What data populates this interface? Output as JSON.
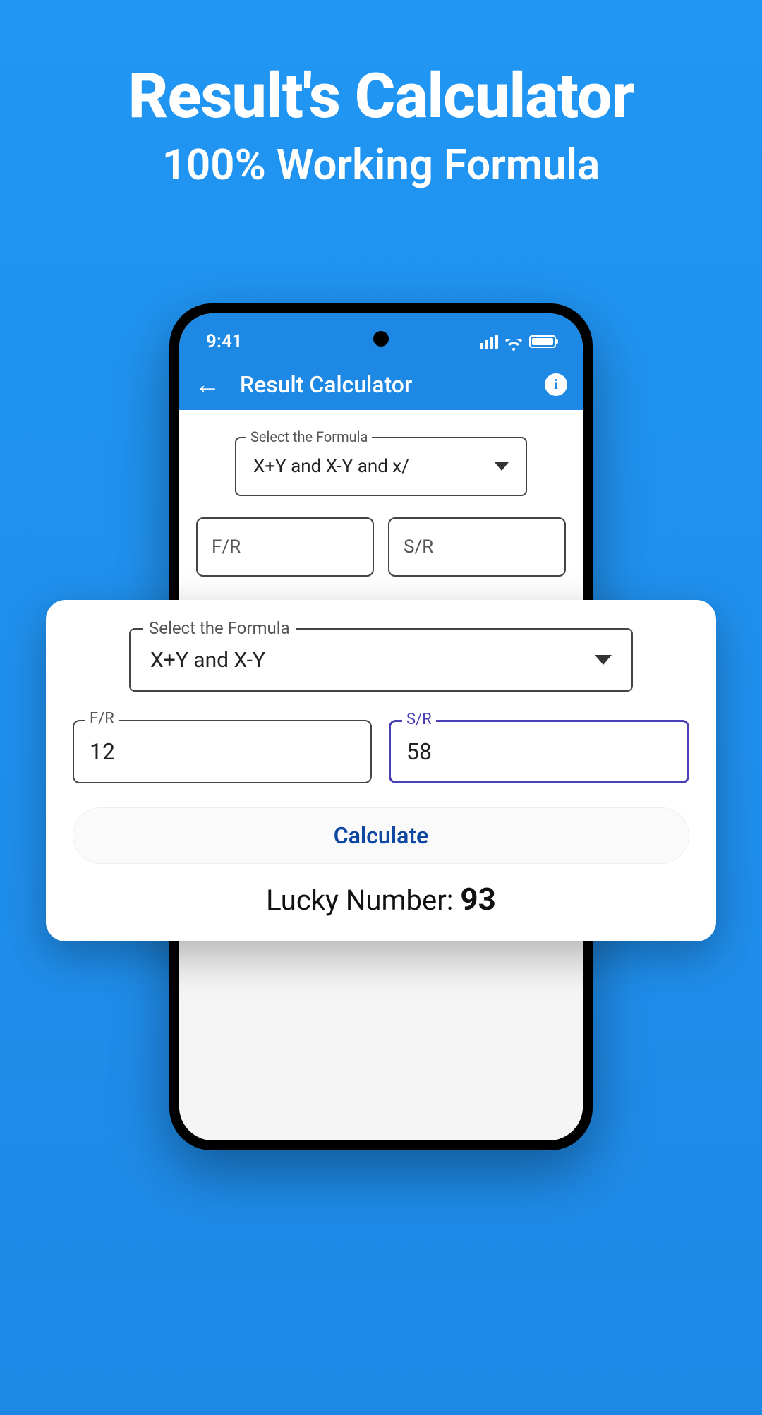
{
  "hero": {
    "title": "Result's Calculator",
    "subtitle": "100% Working Formula"
  },
  "status": {
    "time": "9:41"
  },
  "app_header": {
    "title": "Result Calculator"
  },
  "phone_form": {
    "formula_legend": "Select the Formula",
    "formula_value": "X+Y and X-Y and x/",
    "fr_placeholder": "F/R",
    "sr_placeholder": "S/R"
  },
  "card": {
    "formula_legend": "Select the Formula",
    "formula_value": "X+Y and X-Y",
    "fr_label": "F/R",
    "fr_value": "12",
    "sr_label": "S/R",
    "sr_value": "58",
    "calculate_label": "Calculate",
    "lucky_label": "Lucky Number: ",
    "lucky_value": "93"
  }
}
